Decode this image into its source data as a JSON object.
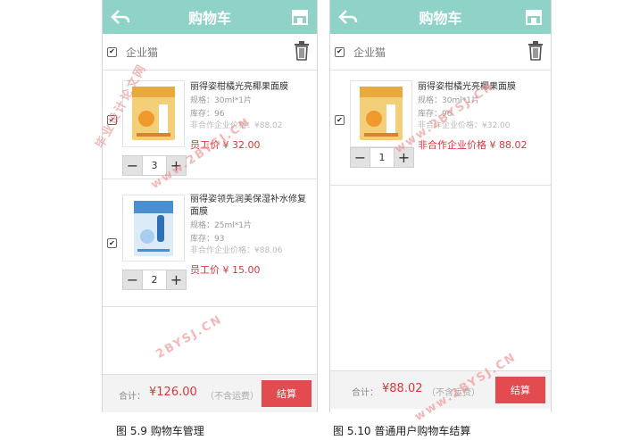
{
  "header": {
    "title": "购物车"
  },
  "company": {
    "name": "企业猫"
  },
  "phone1": {
    "items": [
      {
        "name": "丽得姿柑橘光亮椰果面膜",
        "spec": "规格：30ml*1片",
        "stock": "库存：96",
        "partner_price": "非合作企业价格：¥88.02",
        "price": "员工价 ¥ 32.00",
        "qty": "3"
      },
      {
        "name": "丽得姿领先润美保湿补水修复面膜",
        "spec": "规格：25ml*1片",
        "stock": "库存：93",
        "partner_price": "非合作企业价格：¥88.06",
        "price": "员工价 ¥ 15.00",
        "qty": "2"
      }
    ],
    "footer": {
      "total_label": "合计：",
      "total": "¥126.00",
      "shipping": "（不含运费）",
      "checkout": "结算"
    },
    "caption": "图 5.9 购物车管理"
  },
  "phone2": {
    "items": [
      {
        "name": "丽得姿柑橘光亮椰果面膜",
        "spec": "规格：30ml*1片",
        "stock": "库存：96",
        "partner_price": "非合作企业价格：¥32.00",
        "price": "非合作企业价格 ¥ 88.02",
        "qty": "1"
      }
    ],
    "footer": {
      "total_label": "合计：",
      "total": "¥88.02",
      "shipping": "（不含运费）",
      "checkout": "结算"
    },
    "caption": "图 5.10 普通用户购物车结算"
  },
  "watermark": {
    "line1": "毕业设计论文网",
    "line2": "www.2BYSJ.CN",
    "line3": "2BYSJ.CN"
  },
  "colors": {
    "header": "#8fd3c8",
    "price": "#e0343b",
    "checkout": "#e24c50"
  }
}
